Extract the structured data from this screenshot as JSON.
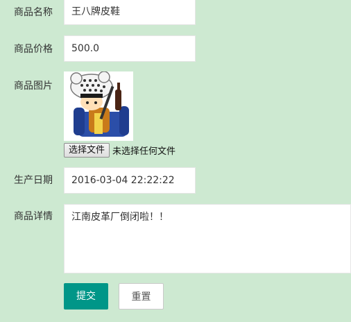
{
  "form": {
    "name": {
      "label": "商品名称",
      "value": "王八牌皮鞋"
    },
    "price": {
      "label": "商品价格",
      "value": "500.0"
    },
    "image": {
      "label": "商品图片",
      "file_button": "选择文件",
      "file_status": "未选择任何文件"
    },
    "date": {
      "label": "生产日期",
      "value": "2016-03-04 22:22:22"
    },
    "detail": {
      "label": "商品详情",
      "value": "江南皮革厂倒闭啦！！"
    },
    "submit_label": "提交",
    "reset_label": "重置"
  },
  "colors": {
    "background": "#cde9d1",
    "primary": "#009688"
  },
  "icons": {
    "image_preview": "cartoon-character-image"
  }
}
